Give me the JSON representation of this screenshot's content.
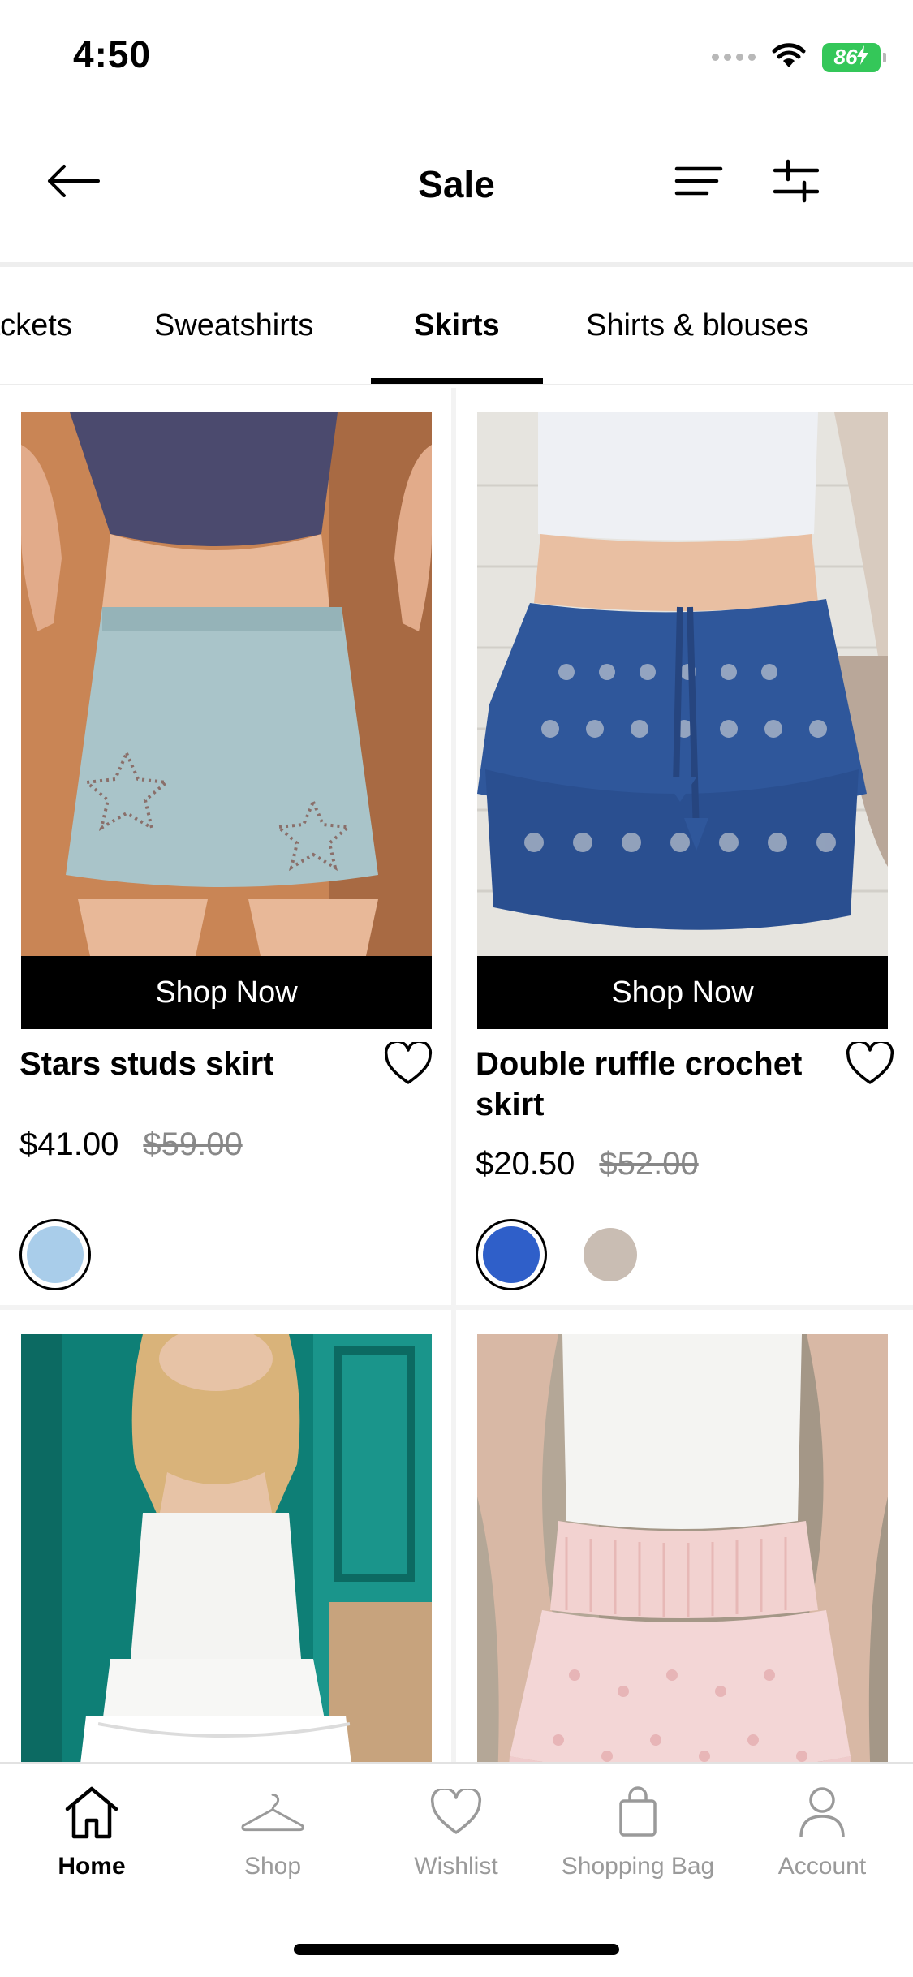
{
  "status_bar": {
    "time": "4:50",
    "battery": "86"
  },
  "header": {
    "title": "Sale",
    "back_icon": "arrow-left-icon",
    "sort_icon": "sort-lines-icon",
    "filter_icon": "sliders-icon"
  },
  "tabs": [
    {
      "label": "Jackets"
    },
    {
      "label": "Sweatshirts"
    },
    {
      "label": "Skirts",
      "active": true
    },
    {
      "label": "Shirts & blouses"
    }
  ],
  "products": [
    {
      "name": "Stars studs skirt",
      "price": "$41.00",
      "original_price": "$59.00",
      "cta": "Shop Now",
      "swatches": [
        {
          "color": "#a9cdea",
          "selected": true
        }
      ]
    },
    {
      "name": "Double ruffle crochet skirt",
      "price": "$20.50",
      "original_price": "$52.00",
      "cta": "Shop Now",
      "swatches": [
        {
          "color": "#2f5fc9",
          "selected": true
        },
        {
          "color": "#c9bdb3",
          "selected": false
        }
      ]
    }
  ],
  "bottom_nav": [
    {
      "label": "Home",
      "icon": "home-icon",
      "active": true
    },
    {
      "label": "Shop",
      "icon": "hanger-icon",
      "active": false
    },
    {
      "label": "Wishlist",
      "icon": "heart-icon",
      "active": false
    },
    {
      "label": "Shopping Bag",
      "icon": "shopping-bag-icon",
      "active": false
    },
    {
      "label": "Account",
      "icon": "user-icon",
      "active": false
    }
  ],
  "colors": {
    "accent": "#000000",
    "battery": "#34c759",
    "inactive_nav": "#9a9a9a",
    "strikethrough_price": "#888888"
  }
}
